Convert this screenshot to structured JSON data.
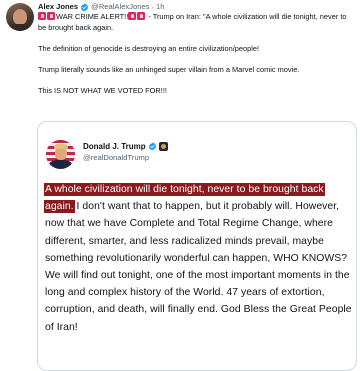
{
  "post": {
    "author_name": "Alex Jones",
    "author_handle": "@RealAlexJones",
    "separator": "·",
    "time": "1h",
    "line1_text": "WAR CRIME ALERT!!",
    "line1_rest": " - Trump on Iran: \"A whole civilization will die tonight, never to be brought back again.",
    "para2": "The definition of genocide is destroying an entire civilization/people!",
    "para3": "Trump literally sounds like an unhinged super villain from a Marvel comic movie.",
    "para4": "This IS NOT WHAT WE VOTED FOR!!!",
    "icons": {
      "verified": "verified-badge-icon",
      "alarm": "rotating-light-emoji"
    }
  },
  "quoted": {
    "author_name": "Donald J. Trump",
    "author_handle": "@realDonaldTrump",
    "highlighted_text": "A whole civilization will die tonight, never to be brought back again.",
    "rest_text": " I don't want that to happen, but it probably will. However, now that we have Complete and Total Regime Change, where different, smarter, and less radicalized minds prevail, maybe something revolutionarily wonderful can happen, WHO KNOWS? We will find out tonight, one of the most important moments in the long and complex history of the World. 47 years of extortion, corruption, and death, will finally end. God Bless the Great People of Iran!",
    "icons": {
      "verified": "verified-badge-icon",
      "affiliation": "presidential-seal-badge-icon"
    }
  },
  "colors": {
    "text": "#0f1419",
    "secondary": "#536471",
    "verified_blue": "#1d9bf0",
    "highlight_bg": "#8b1a1f",
    "border": "#cfd9de"
  }
}
